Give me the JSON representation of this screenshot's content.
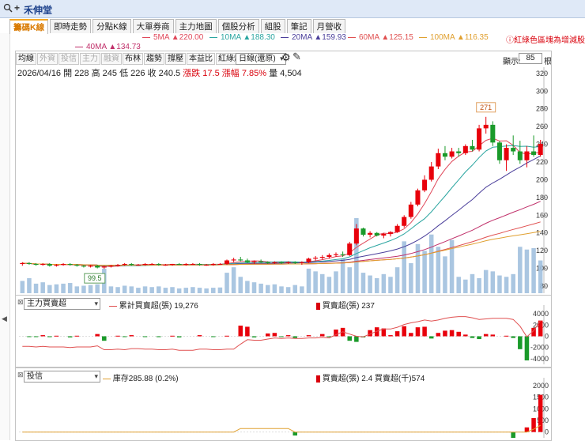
{
  "window": {
    "zoom_icon": "magnifier-icon",
    "title": "禾伸堂"
  },
  "tabs": [
    {
      "label": "籌碼K線",
      "active": true
    },
    {
      "label": "即時走勢"
    },
    {
      "label": "分點K線"
    },
    {
      "label": "大單券商"
    },
    {
      "label": "主力地圖"
    },
    {
      "label": "個股分析"
    },
    {
      "label": "組股"
    },
    {
      "label": "筆記"
    },
    {
      "label": "月營收"
    }
  ],
  "ma": [
    {
      "label": "5MA",
      "value": "▲220.00",
      "color": "#e0485a"
    },
    {
      "label": "10MA",
      "value": "▲188.30",
      "color": "#2aa5a0"
    },
    {
      "label": "20MA",
      "value": "▲159.93",
      "color": "#4a3e9a"
    },
    {
      "label": "60MA",
      "value": "▲125.15",
      "color": "#e05050"
    },
    {
      "label": "100MA",
      "value": "▲116.35",
      "color": "#e0a030"
    },
    {
      "label": "40MA",
      "value": "▲134.73",
      "color": "#c0306a"
    }
  ],
  "color_note": "ⓘ紅綠色區塊為增減股",
  "toolbar": {
    "buttons": [
      {
        "label": "均線",
        "dim": false
      },
      {
        "label": "外資",
        "dim": true
      },
      {
        "label": "投信",
        "dim": true
      },
      {
        "label": "主力",
        "dim": true
      },
      {
        "label": "融資",
        "dim": true
      },
      {
        "label": "布林",
        "dim": false
      },
      {
        "label": "趨勢",
        "dim": false
      },
      {
        "label": "撐壓",
        "dim": false
      },
      {
        "label": "本益比",
        "dim": false
      },
      {
        "label": "紅綠燈",
        "dim": false
      },
      {
        "label": "分價量",
        "dim": true
      }
    ],
    "period": "日線(還原)",
    "display_label": "顯示:",
    "display_count": "85",
    "display_unit": "根"
  },
  "quote": {
    "date": "2026/04/16",
    "open_label": "開",
    "open": "228",
    "high_label": "高",
    "high": "245",
    "low_label": "低",
    "low": "226",
    "close_label": "收",
    "close": "240.5",
    "change": "漲跌 17.5",
    "pct": "漲幅 7.85%",
    "vol_label": "量",
    "vol": "4,504"
  },
  "chart_data": [
    {
      "type": "candlestick",
      "y_ticks": [
        80,
        100,
        120,
        140,
        160,
        180,
        200,
        220,
        240,
        260,
        280,
        300,
        320
      ],
      "low_label": "99.5",
      "high_label": "271",
      "candles": [
        [
          105,
          107,
          103,
          106
        ],
        [
          106,
          107,
          104,
          105
        ],
        [
          105,
          106,
          103,
          104
        ],
        [
          104,
          106,
          103,
          105
        ],
        [
          105,
          106,
          102,
          103
        ],
        [
          103,
          105,
          102,
          104
        ],
        [
          104,
          106,
          103,
          105
        ],
        [
          105,
          106,
          103,
          104
        ],
        [
          104,
          105,
          102,
          103
        ],
        [
          103,
          104,
          101,
          102
        ],
        [
          102,
          104,
          101,
          103
        ],
        [
          103,
          104,
          100,
          101
        ],
        [
          101,
          103,
          99.5,
          102
        ],
        [
          102,
          104,
          101,
          103
        ],
        [
          103,
          105,
          102,
          104
        ],
        [
          104,
          106,
          103,
          105
        ],
        [
          105,
          106,
          103,
          104
        ],
        [
          104,
          105,
          103,
          104
        ],
        [
          104,
          106,
          103,
          105
        ],
        [
          105,
          106,
          104,
          105
        ],
        [
          105,
          106,
          103,
          104
        ],
        [
          104,
          105,
          103,
          104
        ],
        [
          104,
          105,
          103,
          105
        ],
        [
          105,
          106,
          104,
          104
        ],
        [
          104,
          106,
          103,
          105
        ],
        [
          105,
          106,
          104,
          105
        ],
        [
          105,
          106,
          103,
          104
        ],
        [
          104,
          105,
          103,
          104
        ],
        [
          104,
          106,
          103,
          105
        ],
        [
          105,
          106,
          104,
          105
        ],
        [
          105,
          110,
          104,
          109
        ],
        [
          109,
          112,
          107,
          110
        ],
        [
          110,
          113,
          108,
          109
        ],
        [
          109,
          111,
          106,
          107
        ],
        [
          107,
          109,
          105,
          108
        ],
        [
          108,
          110,
          106,
          107
        ],
        [
          107,
          108,
          105,
          106
        ],
        [
          106,
          108,
          105,
          107
        ],
        [
          107,
          108,
          105,
          106
        ],
        [
          106,
          108,
          105,
          107
        ],
        [
          107,
          108,
          105,
          106
        ],
        [
          106,
          108,
          104,
          107
        ],
        [
          107,
          112,
          106,
          111
        ],
        [
          111,
          114,
          109,
          112
        ],
        [
          112,
          115,
          110,
          113
        ],
        [
          113,
          117,
          111,
          115
        ],
        [
          115,
          118,
          113,
          116
        ],
        [
          116,
          119,
          113,
          115
        ],
        [
          115,
          130,
          114,
          128
        ],
        [
          128,
          150,
          126,
          145
        ],
        [
          145,
          146,
          136,
          138
        ],
        [
          138,
          142,
          135,
          140
        ],
        [
          140,
          141,
          136,
          137
        ],
        [
          137,
          140,
          134,
          139
        ],
        [
          139,
          142,
          136,
          141
        ],
        [
          141,
          150,
          140,
          148
        ],
        [
          148,
          160,
          146,
          158
        ],
        [
          158,
          175,
          156,
          172
        ],
        [
          172,
          190,
          170,
          188
        ],
        [
          188,
          205,
          186,
          200
        ],
        [
          200,
          220,
          198,
          215
        ],
        [
          215,
          235,
          212,
          230
        ],
        [
          230,
          238,
          222,
          226
        ],
        [
          226,
          236,
          224,
          232
        ],
        [
          232,
          236,
          226,
          230
        ],
        [
          230,
          240,
          228,
          238
        ],
        [
          238,
          245,
          232,
          234
        ],
        [
          234,
          262,
          232,
          258
        ],
        [
          258,
          271,
          252,
          262
        ],
        [
          262,
          266,
          238,
          242
        ],
        [
          242,
          244,
          218,
          222
        ],
        [
          222,
          240,
          210,
          236
        ],
        [
          236,
          250,
          228,
          232
        ],
        [
          232,
          244,
          218,
          222
        ],
        [
          222,
          238,
          214,
          232
        ],
        [
          232,
          250,
          226,
          228
        ],
        [
          228,
          245,
          226,
          240.5
        ]
      ],
      "volume": [
        900,
        1100,
        700,
        800,
        600,
        650,
        700,
        750,
        500,
        550,
        600,
        650,
        1800,
        500,
        450,
        550,
        500,
        400,
        500,
        450,
        500,
        400,
        450,
        350,
        400,
        450,
        400,
        350,
        400,
        420,
        1500,
        1900,
        1200,
        900,
        800,
        700,
        600,
        650,
        500,
        450,
        600,
        500,
        1800,
        1600,
        1400,
        1200,
        1600,
        2500,
        1900,
        5500,
        1500,
        1300,
        1100,
        1400,
        1200,
        1900,
        3800,
        2200,
        3600,
        3100,
        4300,
        3400,
        2700,
        3900,
        1200,
        1000,
        1400,
        1100,
        1700,
        1600,
        1300,
        1200,
        1400,
        3400,
        3200,
        3300,
        2400
      ]
    },
    {
      "type": "bar+line",
      "indicator": "主力買賣超",
      "cum_label": "累計買賣超(張)",
      "cum_value": "19,276",
      "net_label": "買賣超(張)",
      "net_value": "237",
      "y_ticks": [
        4000,
        2000,
        0,
        -2000,
        -4000
      ],
      "bars": [
        0,
        -100,
        -100,
        200,
        -150,
        100,
        0,
        -200,
        100,
        0,
        0,
        400,
        -800,
        0,
        100,
        -100,
        200,
        0,
        -100,
        0,
        -150,
        0,
        100,
        -200,
        0,
        0,
        200,
        0,
        -100,
        0,
        100,
        0,
        1900,
        1700,
        -200,
        0,
        500,
        600,
        -100,
        200,
        -300,
        0,
        200,
        0,
        400,
        -100,
        1200,
        1500,
        -800,
        -1000,
        -200,
        1100,
        1600,
        1400,
        200,
        900,
        1800,
        600,
        1600,
        1700,
        -400,
        600,
        1000,
        1100,
        800,
        300,
        -300,
        -500,
        400,
        300,
        0,
        100,
        -300,
        -2300,
        -4300,
        1500,
        2800
      ],
      "cum": [
        -1800,
        -1800,
        -1900,
        -1800,
        -1900,
        -1900,
        -1900,
        -2000,
        -1900,
        -1900,
        -1900,
        -1700,
        -2400,
        -2400,
        -2300,
        -2400,
        -2200,
        -2200,
        -2300,
        -2300,
        -2400,
        -2400,
        -2300,
        -2500,
        -2500,
        -2500,
        -2300,
        -2300,
        -2400,
        -2400,
        -2300,
        -2300,
        -1400,
        -600,
        -700,
        -700,
        -500,
        -300,
        -400,
        -300,
        -400,
        -400,
        -300,
        -300,
        -200,
        -300,
        300,
        800,
        400,
        0,
        -100,
        400,
        900,
        1300,
        1300,
        1600,
        2100,
        2400,
        2600,
        2900,
        2700,
        2900,
        3200,
        3400,
        3500,
        3500,
        3300,
        3000,
        3100,
        3200,
        3200,
        3200,
        3000,
        1800,
        -100,
        1000,
        2800
      ]
    },
    {
      "type": "bar+line",
      "indicator": "投信",
      "inventory_label": "庫存",
      "inventory_value": "285.88 (0.2%)",
      "net_label": "買賣超(張)",
      "net_value": "2.4",
      "amount_label": "買賣超(千)",
      "amount_value": "574",
      "y_ticks": [
        2000,
        1500,
        1000,
        500,
        0
      ],
      "bars": [
        0,
        0,
        0,
        0,
        0,
        0,
        0,
        0,
        0,
        0,
        0,
        0,
        0,
        0,
        0,
        0,
        0,
        0,
        0,
        0,
        0,
        0,
        0,
        0,
        0,
        0,
        0,
        0,
        0,
        0,
        0,
        0,
        0,
        0,
        0,
        0,
        0,
        0,
        0,
        0,
        -150,
        0,
        0,
        0,
        0,
        0,
        0,
        0,
        0,
        0,
        0,
        0,
        0,
        0,
        0,
        0,
        0,
        0,
        0,
        0,
        0,
        0,
        0,
        0,
        0,
        0,
        0,
        0,
        0,
        0,
        0,
        0,
        -250,
        0,
        200,
        600,
        1600
      ],
      "inventory": [
        0,
        0,
        0,
        0,
        0,
        0,
        0,
        0,
        0,
        0,
        0,
        0,
        0,
        0,
        0,
        0,
        0,
        0,
        0,
        0,
        0,
        0,
        0,
        0,
        0,
        0,
        0,
        0,
        0,
        0,
        0,
        0,
        150,
        150,
        150,
        150,
        150,
        150,
        150,
        150,
        0,
        0,
        0,
        0,
        0,
        0,
        0,
        0,
        0,
        0,
        0,
        0,
        0,
        0,
        0,
        0,
        0,
        0,
        0,
        0,
        0,
        0,
        0,
        0,
        0,
        0,
        0,
        0,
        0,
        0,
        0,
        0,
        0,
        0,
        0,
        120,
        286
      ]
    }
  ]
}
